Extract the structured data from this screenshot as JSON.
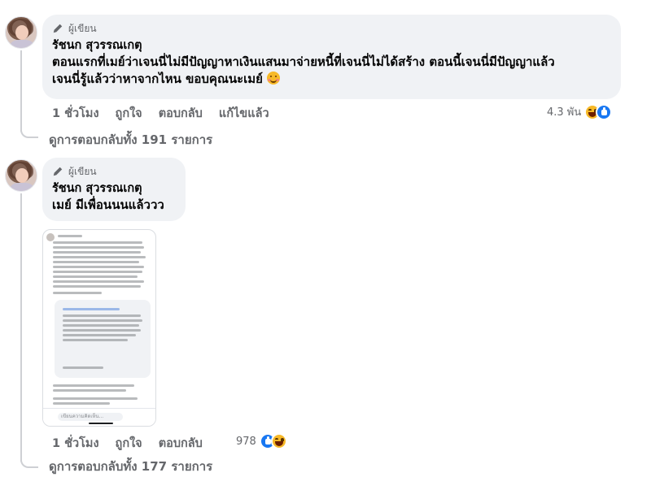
{
  "comments": [
    {
      "author_tag": "ผู้เขียน",
      "author_name": "รัชนก สุวรรณเกตุ",
      "text_line1": "ตอนแรกที่เมย์ว่าเจนนี่ไม่มีปัญญาหาเงินแสนมาจ่ายหนี้ที่เจนนี่ไม่ได้สร้าง ตอนนี้เจนนี่มีปัญญาแล้ว",
      "text_line2": "เจนนี่รู้แล้วว่าหาจากไหน ขอบคุณนะเมย์",
      "time": "1 ชั่วโมง",
      "like_label": "ถูกใจ",
      "reply_label": "ตอบกลับ",
      "edited_label": "แก้ไขแล้ว",
      "reaction_count": "4.3 พัน",
      "view_replies": "ดูการตอบกลับทั้ง 191 รายการ"
    },
    {
      "author_tag": "ผู้เขียน",
      "author_name": "รัชนก สุวรรณเกตุ",
      "text_line1": "เมย์ มีเพื่อนนนแล้ววว",
      "time": "1 ชั่วโมง",
      "like_label": "ถูกใจ",
      "reply_label": "ตอบกลับ",
      "reaction_count": "978",
      "view_replies": "ดูการตอบกลับทั้ง 177 รายการ",
      "attachment_input_placeholder": "เขียนความคิดเห็น..."
    }
  ],
  "colors": {
    "bubble": "#f0f2f5",
    "secondary_text": "#65676b",
    "like_blue": "#1877f2",
    "haha_yellow": "#f7b928"
  }
}
